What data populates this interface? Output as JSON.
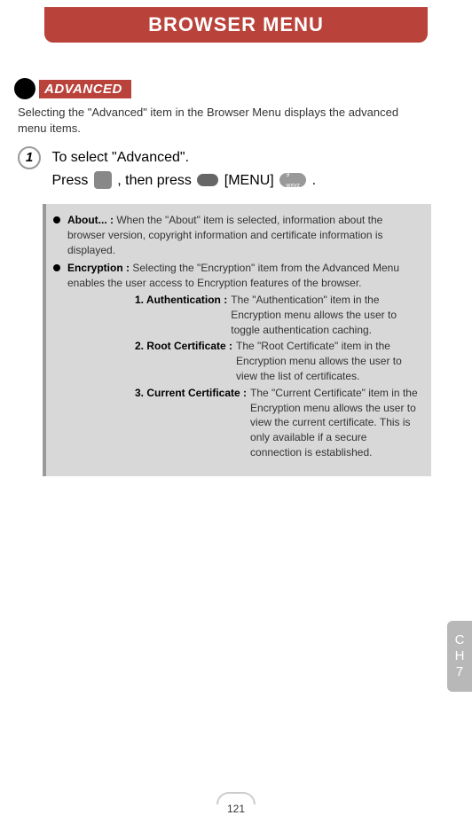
{
  "title": "BROWSER MENU",
  "section_label": "ADVANCED",
  "intro": "Selecting the \"Advanced\" item in the Browser Menu displays the advanced menu items.",
  "step": {
    "number": "1",
    "line1": "To select \"Advanced\".",
    "line2a": "Press ",
    "line2b": " , then press ",
    "line2c": " [MENU] ",
    "line2d": " ."
  },
  "items": [
    {
      "label": "About... : ",
      "desc": "When the \"About\" item is selected, information about the browser version, copyright information and certificate information is displayed."
    },
    {
      "label": "Encryption : ",
      "desc": "Selecting the \"Encryption\" item from the Advanced Menu enables the user access to Encryption features of the browser.",
      "subs": [
        {
          "label": "1. Authentication : ",
          "desc": "The \"Authentication\" item in the Encryption menu allows the user to toggle authentication caching."
        },
        {
          "label": "2. Root Certificate : ",
          "desc": "The \"Root Certificate\" item in the Encryption menu allows the user to view the list of certificates."
        },
        {
          "label": "3. Current Certificate : ",
          "desc": "The \"Current Certificate\" item in the Encryption menu allows the user to view the current certificate. This is only available if a secure connection is established."
        }
      ]
    }
  ],
  "chapter": {
    "c": "C",
    "h": "H",
    "n": "7"
  },
  "page": "121",
  "key9": "9 wxyz"
}
